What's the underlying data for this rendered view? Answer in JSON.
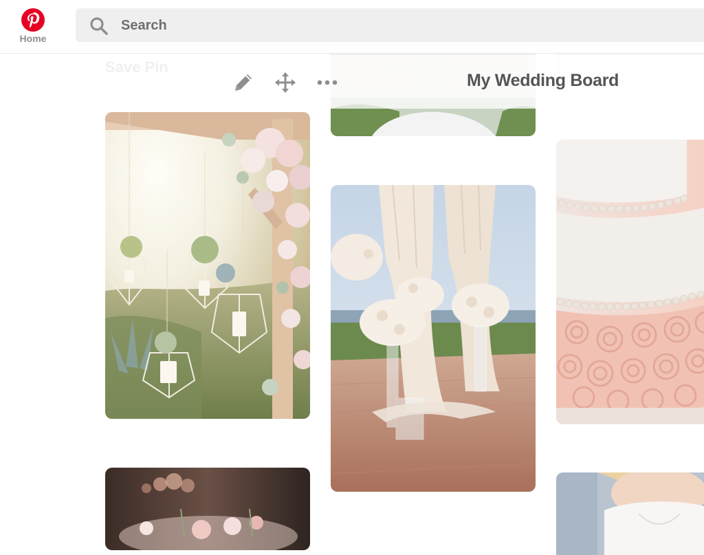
{
  "nav": {
    "home_label": "Home",
    "logo_icon": "pinterest-logo-icon",
    "brand_color": "#e60023"
  },
  "search": {
    "placeholder": "Search",
    "value": "",
    "icon": "search-icon"
  },
  "board": {
    "title": "My Wedding Board",
    "save_pin_label": "Save Pin",
    "tools": [
      {
        "name": "edit",
        "icon": "pencil-icon"
      },
      {
        "name": "move",
        "icon": "move-arrows-icon"
      },
      {
        "name": "more",
        "icon": "more-dots-icon"
      }
    ]
  },
  "pins": [
    {
      "name": "hanging-geometric-terrariums",
      "icon": "photo"
    },
    {
      "name": "outdoor-ceremony-aisle-florals",
      "icon": "photo"
    },
    {
      "name": "pink-rosette-wedding-cake",
      "icon": "photo"
    },
    {
      "name": "pink-bouquet-table",
      "icon": "photo"
    },
    {
      "name": "bride-dress",
      "icon": "photo"
    }
  ],
  "colors": {
    "icon_gray": "#8e8e8e",
    "search_bg": "#efefef",
    "title_gray": "#555555"
  }
}
